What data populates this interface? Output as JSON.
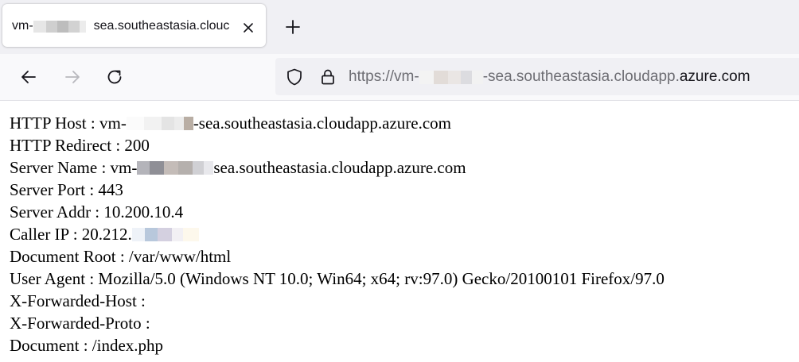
{
  "browser": {
    "tab": {
      "title_prefix": "vm-",
      "title_suffix": "sea.southeastasia.clouc",
      "close_icon": "close-icon"
    },
    "new_tab_icon": "plus-icon",
    "nav": {
      "back_icon": "arrow-left-icon",
      "forward_icon": "arrow-right-icon",
      "reload_icon": "reload-icon"
    },
    "urlbar": {
      "shield_icon": "shield-icon",
      "lock_icon": "lock-icon",
      "url_prefix": "https://vm-",
      "url_middle": "-sea.southeastasia.cloudapp.",
      "url_domain": "azure.com"
    }
  },
  "page": {
    "http_host": {
      "label": "HTTP Host : ",
      "prefix": "vm-",
      "suffix": "-sea.southeastasia.cloudapp.azure.com"
    },
    "http_redirect": {
      "text": "HTTP Redirect : 200"
    },
    "server_name": {
      "label": "Server Name : ",
      "prefix": "vm-",
      "suffix": "sea.southeastasia.cloudapp.azure.com"
    },
    "server_port": {
      "text": "Server Port : 443"
    },
    "server_addr": {
      "text": "Server Addr : 10.200.10.4"
    },
    "caller_ip": {
      "label": "Caller IP : ",
      "prefix": "20.212."
    },
    "document_root": {
      "text": "Document Root : /var/www/html"
    },
    "user_agent": {
      "text": "User Agent : Mozilla/5.0 (Windows NT 10.0; Win64; x64; rv:97.0) Gecko/20100101 Firefox/97.0"
    },
    "x_forwarded_host": {
      "text": "X-Forwarded-Host :"
    },
    "x_forwarded_proto": {
      "text": "X-Forwarded-Proto :"
    },
    "document": {
      "text": "Document : /index.php"
    }
  }
}
